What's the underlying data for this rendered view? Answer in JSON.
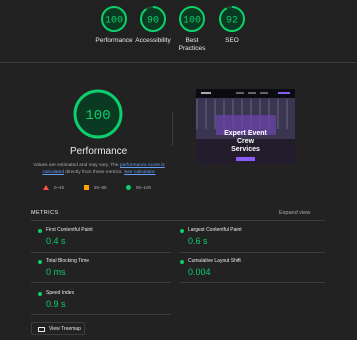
{
  "top_gauges": [
    {
      "score": "100",
      "label": "Performance"
    },
    {
      "score": "90",
      "label": "Accessibility"
    },
    {
      "score": "100",
      "label": "Best\nPractices"
    },
    {
      "score": "92",
      "label": "SEO"
    }
  ],
  "main": {
    "score": "100",
    "title": "Performance",
    "desc_prefix": "Values are estimated and may vary. The ",
    "desc_link1": "performance score is calculated",
    "desc_middle": " directly from these metrics. ",
    "desc_link2": "See calculator."
  },
  "legend": [
    {
      "range": "0–49",
      "color": "#ff4e42"
    },
    {
      "range": "50–89",
      "color": "#ffa400"
    },
    {
      "range": "90–100",
      "color": "#0cce6b"
    }
  ],
  "screenshot": {
    "headline": "Expert Event\nCrew\nServices"
  },
  "metrics": {
    "heading": "METRICS",
    "expand_label": "Expand view",
    "items": [
      {
        "name": "First Contentful Paint",
        "value": "0.4 s"
      },
      {
        "name": "Largest Contentful Paint",
        "value": "0.6 s"
      },
      {
        "name": "Total Blocking Time",
        "value": "0 ms"
      },
      {
        "name": "Cumulative Layout Shift",
        "value": "0.004"
      },
      {
        "name": "Speed Index",
        "value": "0.9 s"
      }
    ]
  },
  "treemap": {
    "label": "View Treemap"
  },
  "colors": {
    "good": "#0cce6b",
    "average": "#ffa400",
    "poor": "#ff4e42",
    "link": "#669df6"
  }
}
